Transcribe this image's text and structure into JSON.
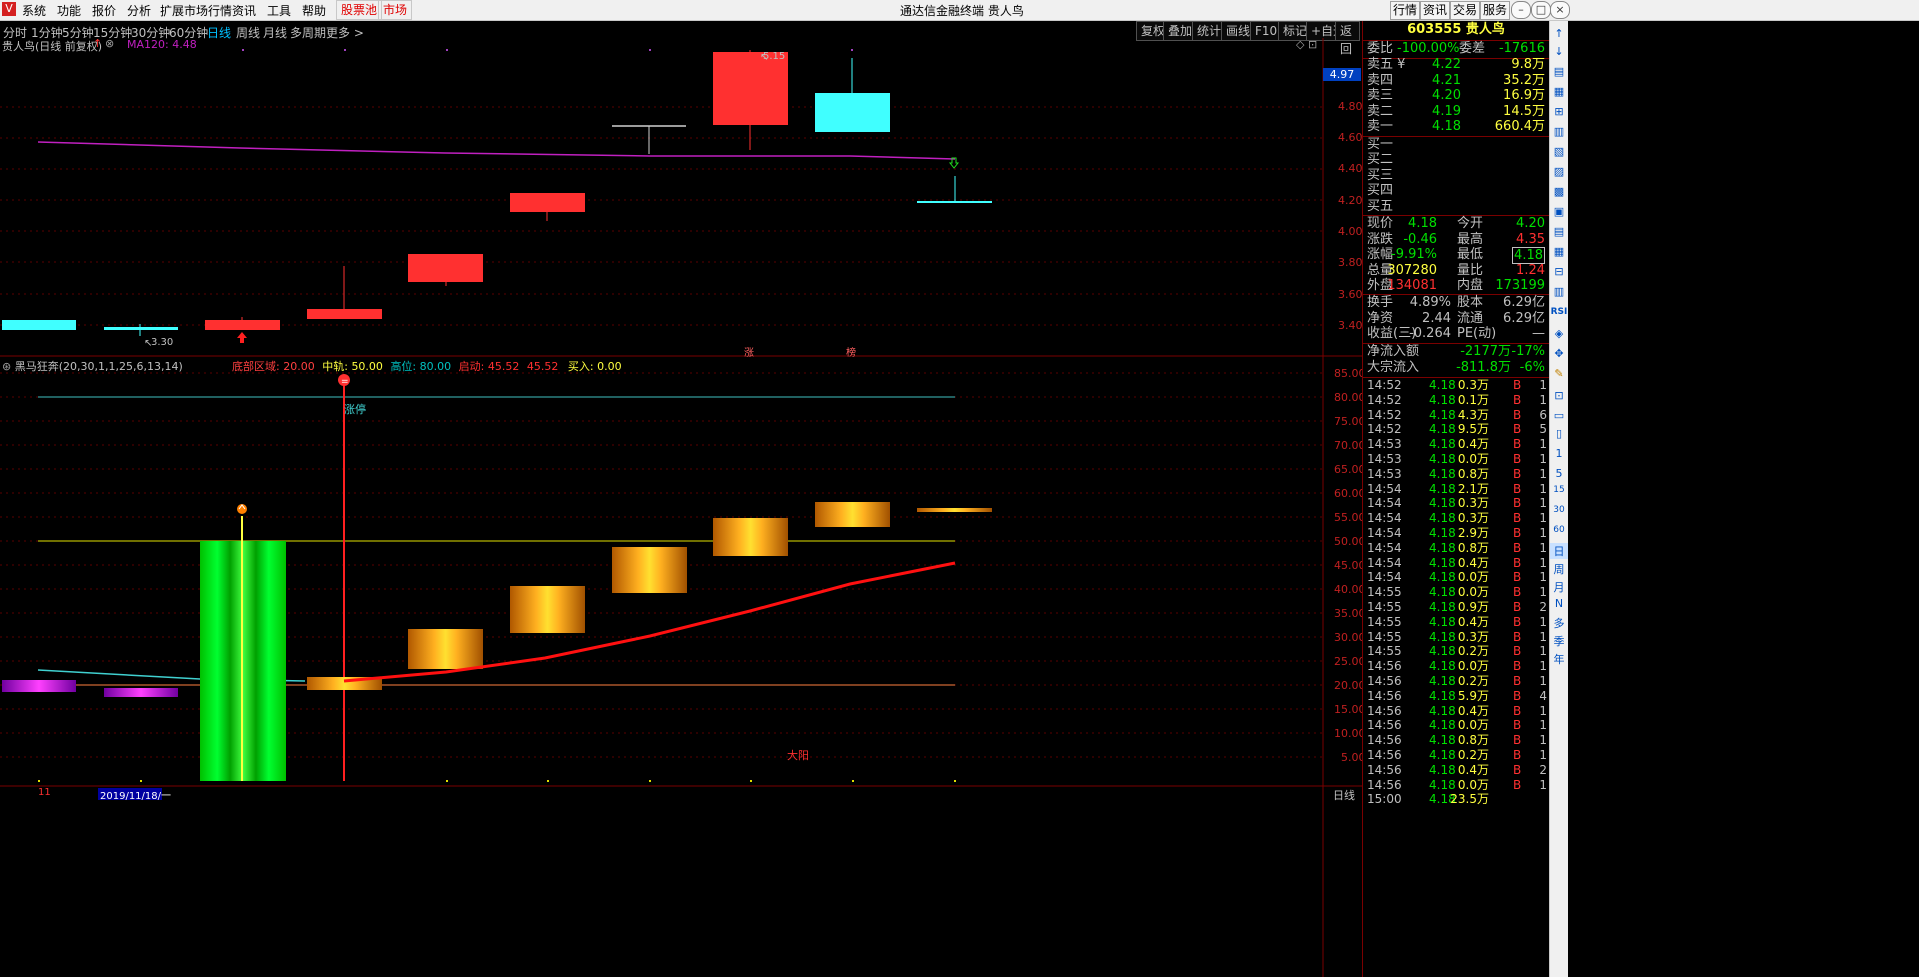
{
  "menu": {
    "logo": "V",
    "items": [
      "系统",
      "功能",
      "报价",
      "分析",
      "扩展市场行情",
      "资讯",
      "工具",
      "帮助"
    ],
    "hot": [
      "股票池",
      "市场"
    ],
    "window_title": "通达信金融终端  贵人鸟",
    "right_buttons": [
      "行情",
      "资讯",
      "交易",
      "服务"
    ]
  },
  "period_bar": {
    "periods": [
      "分时",
      "1分钟",
      "5分钟",
      "15分钟",
      "30分钟",
      "60分钟",
      "日线",
      "周线",
      "月线",
      "多周期",
      "更多 >"
    ],
    "active": "日线",
    "tools": [
      "复权",
      "叠加",
      "统计",
      "画线",
      "F10",
      "标记",
      "+自选",
      "返回"
    ]
  },
  "main_chart": {
    "stock_label": "贵人鸟(日线 前复权)",
    "ma_label": "MA120: 4.48",
    "yaxis": [
      "4.80",
      "4.60",
      "4.40",
      "4.20",
      "4.00",
      "3.80",
      "3.60",
      "3.40"
    ],
    "price_tag": "4.97",
    "high_label": "5.15",
    "low_label": "3.30",
    "markers": [
      "涨",
      "榜"
    ]
  },
  "indicator": {
    "name": "黑马狂奔(20,30,1,1,25,6,13,14)",
    "fields": [
      {
        "label": "底部区域:",
        "value": "20.00",
        "color": "#ff4040"
      },
      {
        "label": "中轨:",
        "value": "50.00",
        "color": "#ffff40"
      },
      {
        "label": "高位:",
        "value": "80.00",
        "color": "#00c0c0"
      },
      {
        "label": "启动:",
        "value": "45.52",
        "color": "#ff3030"
      },
      {
        "label": "",
        "value": "45.52",
        "color": "#ff3030"
      },
      {
        "label": "买入:",
        "value": "0.00",
        "color": "#ffff40"
      }
    ],
    "yaxis": [
      "85.00",
      "80.00",
      "75.00",
      "70.00",
      "65.00",
      "60.00",
      "55.00",
      "50.00",
      "45.00",
      "40.00",
      "35.00",
      "30.00",
      "25.00",
      "20.00",
      "15.00",
      "10.00",
      "5.00"
    ],
    "limit_up_label": "涨停",
    "sun_label": "大阳"
  },
  "bottom": {
    "left_mark": "11",
    "date_label": "2019/11/18/一",
    "period_label": "日线"
  },
  "quote": {
    "code_name": "603555 贵人鸟",
    "weibi": {
      "label": "委比",
      "value": "-100.00%",
      "label2": "委差",
      "value2": "-17616"
    },
    "sells": [
      {
        "label": "卖五 ¥",
        "price": "4.22",
        "vol": "9.8万"
      },
      {
        "label": "卖四",
        "price": "4.21",
        "vol": "35.2万"
      },
      {
        "label": "卖三",
        "price": "4.20",
        "vol": "16.9万"
      },
      {
        "label": "卖二",
        "price": "4.19",
        "vol": "14.5万"
      },
      {
        "label": "卖一",
        "price": "4.18",
        "vol": "660.4万"
      }
    ],
    "buys": [
      "买一",
      "买二",
      "买三",
      "买四",
      "买五"
    ],
    "stats": [
      {
        "l1": "现价",
        "v1": "4.18",
        "c1": "g",
        "l2": "今开",
        "v2": "4.20",
        "c2": "g"
      },
      {
        "l1": "涨跌",
        "v1": "-0.46",
        "c1": "g",
        "l2": "最高",
        "v2": "4.35",
        "c2": "g"
      },
      {
        "l1": "涨幅",
        "v1": "-9.91%",
        "c1": "g",
        "l2": "最低",
        "v2": "4.18",
        "c2": "g"
      },
      {
        "l1": "总量",
        "v1": "307280",
        "c1": "y",
        "l2": "量比",
        "v2": "1.24",
        "c2": "r"
      },
      {
        "l1": "外盘",
        "v1": "134081",
        "c1": "r",
        "l2": "内盘",
        "v2": "173199",
        "c2": "g"
      }
    ],
    "stats2": [
      {
        "l1": "换手",
        "v1": "4.89%",
        "c1": "w",
        "l2": "股本",
        "v2": "6.29亿",
        "c2": "w"
      },
      {
        "l1": "净资",
        "v1": "2.44",
        "c1": "w",
        "l2": "流通",
        "v2": "6.29亿",
        "c2": "w"
      },
      {
        "l1": "收益(三)",
        "v1": "-0.264",
        "c1": "w",
        "l2": "PE(动)",
        "v2": "—",
        "c2": "w"
      }
    ],
    "flows": [
      {
        "label": "净流入额",
        "value": "-2177万",
        "pct": "-17%"
      },
      {
        "label": "大宗流入",
        "value": "-811.8万",
        "pct": "-6%"
      }
    ],
    "ticks": [
      [
        "14:52",
        "4.18",
        "0.3万",
        "B",
        "1"
      ],
      [
        "14:52",
        "4.18",
        "0.1万",
        "B",
        "1"
      ],
      [
        "14:52",
        "4.18",
        "4.3万",
        "B",
        "6"
      ],
      [
        "14:52",
        "4.18",
        "9.5万",
        "B",
        "5"
      ],
      [
        "14:53",
        "4.18",
        "0.4万",
        "B",
        "1"
      ],
      [
        "14:53",
        "4.18",
        "0.0万",
        "B",
        "1"
      ],
      [
        "14:53",
        "4.18",
        "0.8万",
        "B",
        "1"
      ],
      [
        "14:54",
        "4.18",
        "2.1万",
        "B",
        "1"
      ],
      [
        "14:54",
        "4.18",
        "0.3万",
        "B",
        "1"
      ],
      [
        "14:54",
        "4.18",
        "0.3万",
        "B",
        "1"
      ],
      [
        "14:54",
        "4.18",
        "2.9万",
        "B",
        "1"
      ],
      [
        "14:54",
        "4.18",
        "0.8万",
        "B",
        "1"
      ],
      [
        "14:54",
        "4.18",
        "0.4万",
        "B",
        "1"
      ],
      [
        "14:54",
        "4.18",
        "0.0万",
        "B",
        "1"
      ],
      [
        "14:55",
        "4.18",
        "0.0万",
        "B",
        "1"
      ],
      [
        "14:55",
        "4.18",
        "0.9万",
        "B",
        "2"
      ],
      [
        "14:55",
        "4.18",
        "0.4万",
        "B",
        "1"
      ],
      [
        "14:55",
        "4.18",
        "0.3万",
        "B",
        "1"
      ],
      [
        "14:55",
        "4.18",
        "0.2万",
        "B",
        "1"
      ],
      [
        "14:56",
        "4.18",
        "0.0万",
        "B",
        "1"
      ],
      [
        "14:56",
        "4.18",
        "0.2万",
        "B",
        "1"
      ],
      [
        "14:56",
        "4.18",
        "5.9万",
        "B",
        "4"
      ],
      [
        "14:56",
        "4.18",
        "0.4万",
        "B",
        "1"
      ],
      [
        "14:56",
        "4.18",
        "0.0万",
        "B",
        "1"
      ],
      [
        "14:56",
        "4.18",
        "0.8万",
        "B",
        "1"
      ],
      [
        "14:56",
        "4.18",
        "0.2万",
        "B",
        "1"
      ],
      [
        "14:56",
        "4.18",
        "0.4万",
        "B",
        "2"
      ],
      [
        "14:56",
        "4.18",
        "0.0万",
        "B",
        "1"
      ],
      [
        "15:00",
        "4.18",
        "23.5万",
        "",
        ""
      ]
    ]
  },
  "sidebar": {
    "periods": [
      "1",
      "5",
      "15",
      "30",
      "60",
      "日",
      "周",
      "月",
      "N",
      "多",
      "季",
      "年"
    ],
    "tools": [
      "↑",
      "↓",
      "RSI",
      "✥"
    ]
  }
}
